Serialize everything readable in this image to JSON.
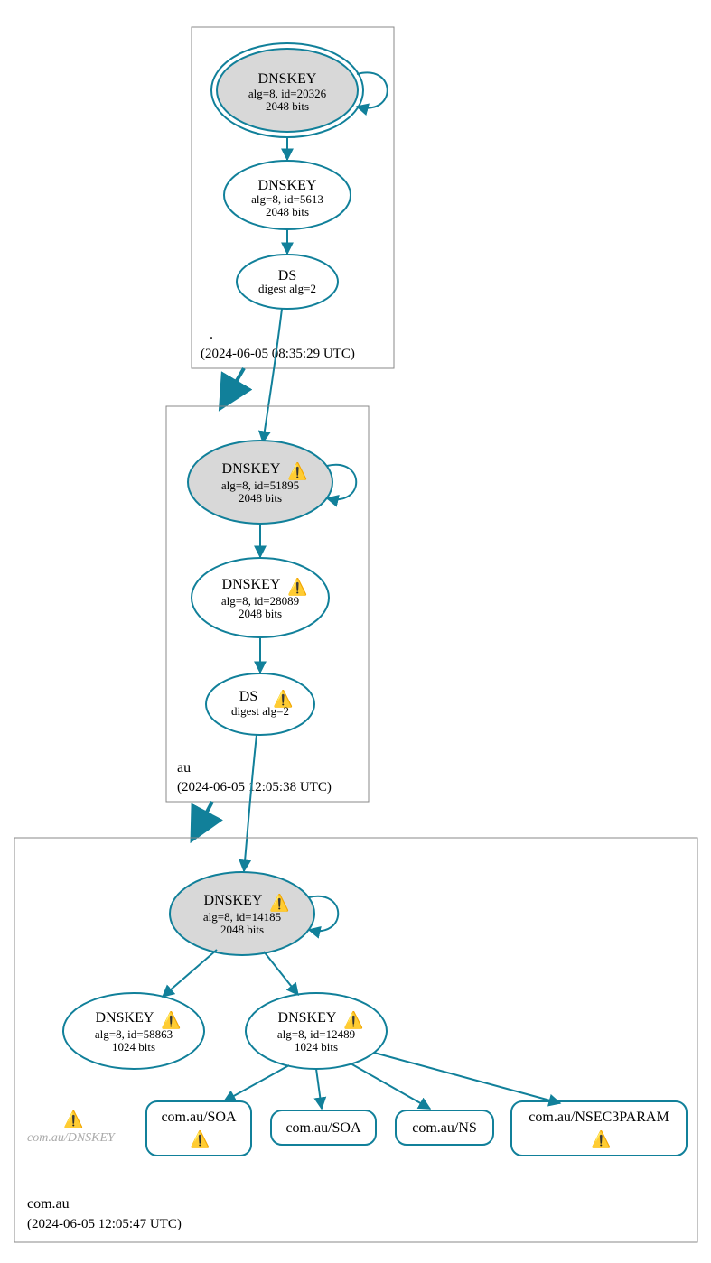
{
  "zones": {
    "root": {
      "label": ".",
      "timestamp": "(2024-06-05 08:35:29 UTC)",
      "dnskey1": {
        "title": "DNSKEY",
        "line1": "alg=8, id=20326",
        "line2": "2048 bits",
        "warn": false
      },
      "dnskey2": {
        "title": "DNSKEY",
        "line1": "alg=8, id=5613",
        "line2": "2048 bits",
        "warn": false
      },
      "ds": {
        "title": "DS",
        "line1": "digest alg=2",
        "warn": false
      }
    },
    "au": {
      "label": "au",
      "timestamp": "(2024-06-05 12:05:38 UTC)",
      "dnskey1": {
        "title": "DNSKEY",
        "line1": "alg=8, id=51895",
        "line2": "2048 bits",
        "warn": true
      },
      "dnskey2": {
        "title": "DNSKEY",
        "line1": "alg=8, id=28089",
        "line2": "2048 bits",
        "warn": true
      },
      "ds": {
        "title": "DS",
        "line1": "digest alg=2",
        "warn": true
      }
    },
    "comau": {
      "label": "com.au",
      "timestamp": "(2024-06-05 12:05:47 UTC)",
      "dnskey1": {
        "title": "DNSKEY",
        "line1": "alg=8, id=14185",
        "line2": "2048 bits",
        "warn": true
      },
      "dnskey2": {
        "title": "DNSKEY",
        "line1": "alg=8, id=58863",
        "line2": "1024 bits",
        "warn": true
      },
      "dnskey3": {
        "title": "DNSKEY",
        "line1": "alg=8, id=12489",
        "line2": "1024 bits",
        "warn": true
      },
      "ghost": "com.au/DNSKEY",
      "records": {
        "r1": {
          "text": "com.au/SOA",
          "warn": true
        },
        "r2": {
          "text": "com.au/SOA",
          "warn": false
        },
        "r3": {
          "text": "com.au/NS",
          "warn": false
        },
        "r4": {
          "text": "com.au/NSEC3PARAM",
          "warn": true
        }
      }
    }
  },
  "icons": {
    "warn": "⚠️"
  }
}
